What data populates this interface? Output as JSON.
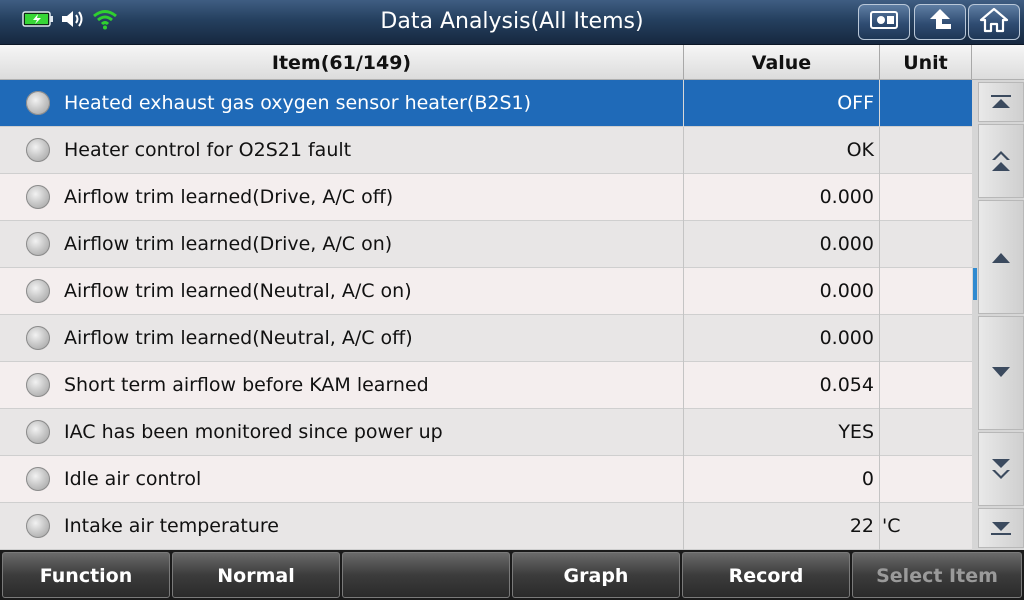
{
  "header": {
    "title": "Data Analysis(All Items)",
    "status_icons": [
      "battery-charging-icon",
      "speaker-icon",
      "wifi-icon"
    ],
    "buttons": [
      "screenshot-icon",
      "back-arrow-icon",
      "home-icon"
    ]
  },
  "table": {
    "headers": {
      "item": "Item(61/149)",
      "value": "Value",
      "unit": "Unit"
    },
    "rows": [
      {
        "name": "Heated exhaust gas oxygen sensor heater(B2S1)",
        "value": "OFF",
        "unit": ""
      },
      {
        "name": "Heater control for O2S21 fault",
        "value": "OK",
        "unit": ""
      },
      {
        "name": "Airflow trim learned(Drive, A/C off)",
        "value": "0.000",
        "unit": ""
      },
      {
        "name": "Airflow trim learned(Drive, A/C on)",
        "value": "0.000",
        "unit": ""
      },
      {
        "name": "Airflow trim learned(Neutral, A/C on)",
        "value": "0.000",
        "unit": ""
      },
      {
        "name": "Airflow trim learned(Neutral, A/C off)",
        "value": "0.000",
        "unit": ""
      },
      {
        "name": "Short term airflow before KAM learned",
        "value": "0.054",
        "unit": ""
      },
      {
        "name": "IAC has been monitored since power up",
        "value": "YES",
        "unit": ""
      },
      {
        "name": "Idle air control",
        "value": "0",
        "unit": ""
      },
      {
        "name": "Intake air temperature",
        "value": "22",
        "unit": "'C"
      }
    ],
    "selected_index": 0
  },
  "scroll": {
    "buttons": [
      "scroll-top-icon",
      "page-up-icon",
      "scroll-up-icon",
      "scroll-down-icon",
      "page-down-icon",
      "scroll-bottom-icon"
    ]
  },
  "toolbar": {
    "function_label": "Function",
    "normal_label": "Normal",
    "blank_label": "",
    "graph_label": "Graph",
    "record_label": "Record",
    "select_item_label": "Select Item"
  },
  "colors": {
    "title_bar": "#25405f",
    "selected_row": "#1f6ab8",
    "wifi": "#2fcf2f",
    "battery": "#37d637",
    "scroll_indicator": "#2f8ad0"
  }
}
